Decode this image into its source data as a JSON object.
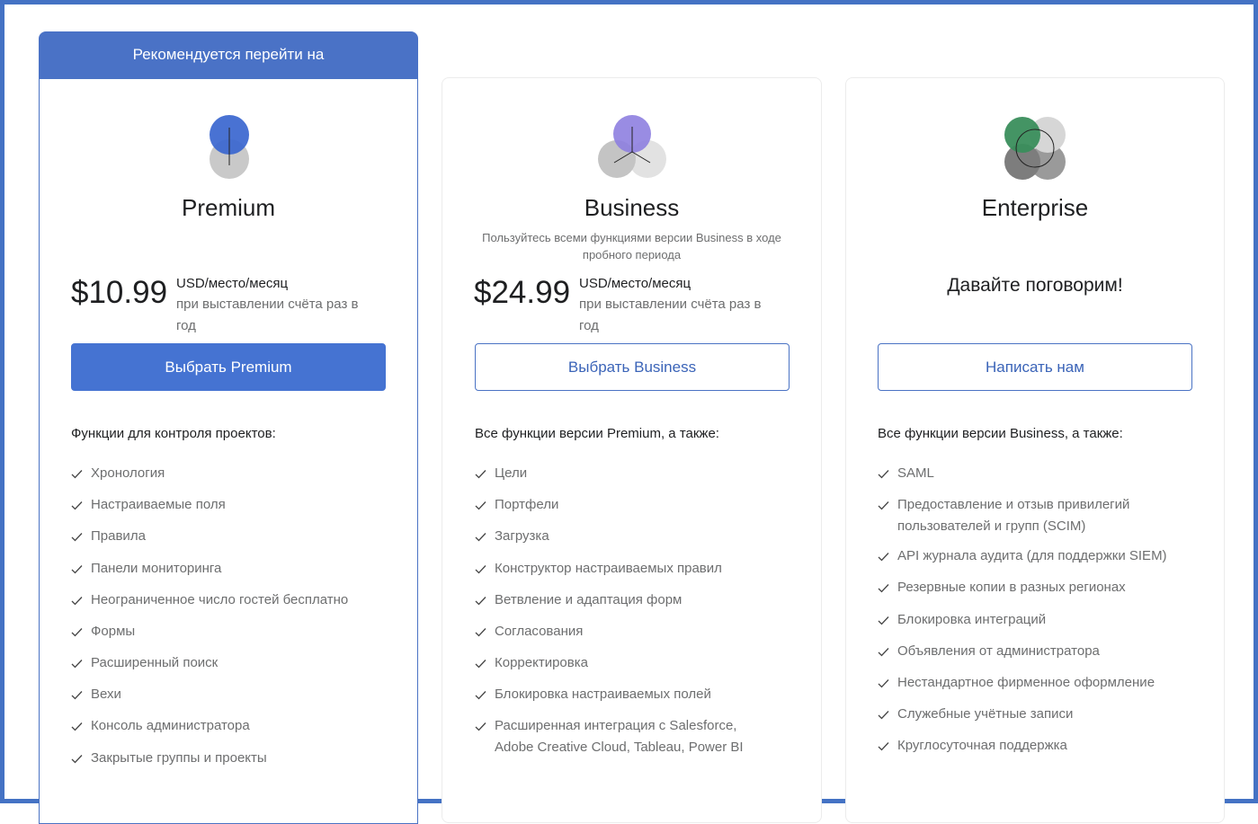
{
  "banner": "Рекомендуется перейти на",
  "plans": [
    {
      "name": "Premium",
      "price": "$10.99",
      "price_unit": "USD/место/месяц",
      "price_note": "при выставлении счёта раз в год",
      "button": "Выбрать Premium",
      "features_heading": "Функции для контроля проектов:",
      "features": [
        "Хронология",
        "Настраиваемые поля",
        "Правила",
        "Панели мониторинга",
        "Неограниченное число гостей бесплатно",
        "Формы",
        "Расширенный поиск",
        "Вехи",
        "Консоль администратора",
        "Закрытые группы и проекты"
      ],
      "logo_color": "#3a66cf"
    },
    {
      "name": "Business",
      "subtitle": "Пользуйтесь всеми функциями версии Business в ходе пробного периода",
      "price": "$24.99",
      "price_unit": "USD/место/месяц",
      "price_note": "при выставлении счёта раз в год",
      "button": "Выбрать Business",
      "features_heading": "Все функции версии Premium, а также:",
      "features": [
        "Цели",
        "Портфели",
        "Загрузка",
        "Конструктор настраиваемых правил",
        "Ветвление и адаптация форм",
        "Согласования",
        "Корректировка",
        "Блокировка настраиваемых полей",
        "Расширенная интеграция с Salesforce, Adobe Creative Cloud, Tableau, Power BI"
      ],
      "logo_color": "#8e7fe0"
    },
    {
      "name": "Enterprise",
      "talk": "Давайте поговорим!",
      "button": "Написать нам",
      "features_heading": "Все функции версии Business, а также:",
      "features": [
        "SAML",
        "Предоставление и отзыв привилегий пользователей и групп (SCIM)",
        "API журнала аудита (для поддержки SIEM)",
        "Резервные копии в разных регионах",
        "Блокировка интеграций",
        "Объявления от администратора",
        "Нестандартное фирменное оформление",
        "Служебные учётные записи",
        "Круглосуточная поддержка"
      ],
      "logo_color": "#3a8e5c"
    }
  ],
  "colors": {
    "accent": "#4573d2",
    "frame": "#4472c4",
    "muted_text": "#6d6e6f"
  }
}
